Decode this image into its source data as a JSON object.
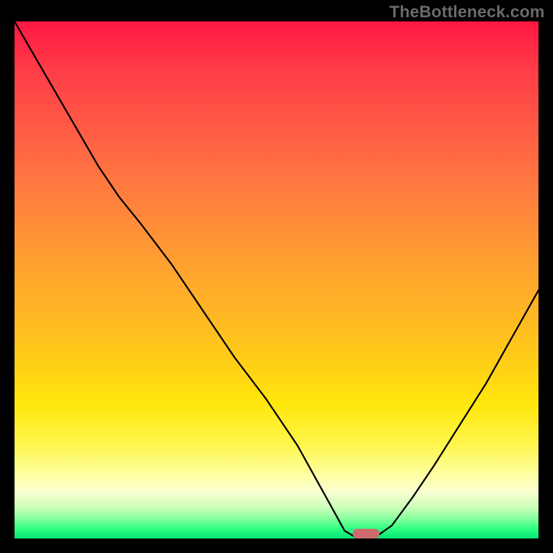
{
  "watermark": "TheBottleneck.com",
  "chart_data": {
    "type": "line",
    "title": "",
    "xlabel": "",
    "ylabel": "",
    "x": [
      0.0,
      0.04,
      0.08,
      0.12,
      0.16,
      0.2,
      0.24,
      0.3,
      0.36,
      0.42,
      0.48,
      0.54,
      0.6,
      0.63,
      0.655,
      0.685,
      0.72,
      0.76,
      0.8,
      0.85,
      0.9,
      0.95,
      1.0
    ],
    "values": [
      1.0,
      0.93,
      0.86,
      0.79,
      0.72,
      0.66,
      0.61,
      0.53,
      0.44,
      0.35,
      0.27,
      0.18,
      0.07,
      0.015,
      0.0,
      0.0,
      0.025,
      0.08,
      0.14,
      0.22,
      0.3,
      0.39,
      0.48
    ],
    "marker_x": 0.67,
    "marker_y": 0.0,
    "xlim": [
      0,
      1
    ],
    "ylim": [
      0,
      1
    ],
    "annotations": []
  },
  "colors": {
    "background": "#000000",
    "curve": "#000000",
    "marker": "#cd6a6e",
    "gradient_top": "#ff1744",
    "gradient_bottom": "#00e676"
  }
}
